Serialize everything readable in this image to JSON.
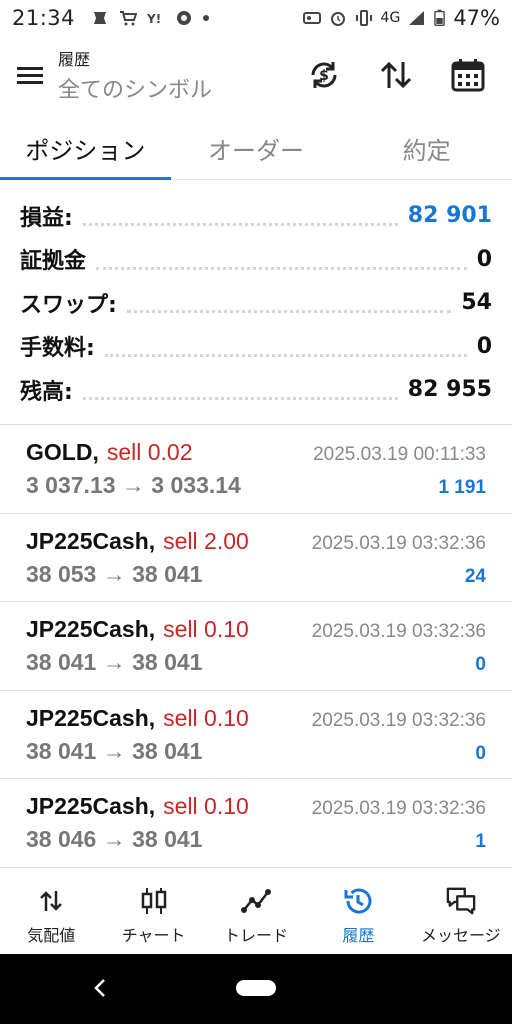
{
  "status_bar": {
    "time": "21:34",
    "network": "4G",
    "battery": "47%"
  },
  "appbar": {
    "title": "履歴",
    "subtitle": "全てのシンボル",
    "icons": [
      "menu-icon",
      "currency-sync-icon",
      "sort-icon",
      "calendar-icon"
    ]
  },
  "tabs": [
    {
      "label": "ポジション",
      "active": true
    },
    {
      "label": "オーダー",
      "active": false
    },
    {
      "label": "約定",
      "active": false
    }
  ],
  "summary": [
    {
      "label": "損益:",
      "value": "82 901",
      "color": "#1976d2"
    },
    {
      "label": "証拠金",
      "value": "0",
      "color": "#111111"
    },
    {
      "label": "スワップ:",
      "value": "54",
      "color": "#111111"
    },
    {
      "label": "手数料:",
      "value": "0",
      "color": "#111111"
    },
    {
      "label": "残高:",
      "value": "82 955",
      "color": "#111111"
    }
  ],
  "deals": [
    {
      "symbol": "GOLD,",
      "side": "sell 0.02",
      "time": "2025.03.19 00:11:33",
      "prices": "3 037.13 → 3 033.14",
      "profit": "1 191"
    },
    {
      "symbol": "JP225Cash,",
      "side": "sell 2.00",
      "time": "2025.03.19 03:32:36",
      "prices": "38 053 → 38 041",
      "profit": "24"
    },
    {
      "symbol": "JP225Cash,",
      "side": "sell 0.10",
      "time": "2025.03.19 03:32:36",
      "prices": "38 041 → 38 041",
      "profit": "0"
    },
    {
      "symbol": "JP225Cash,",
      "side": "sell 0.10",
      "time": "2025.03.19 03:32:36",
      "prices": "38 041 → 38 041",
      "profit": "0"
    },
    {
      "symbol": "JP225Cash,",
      "side": "sell 0.10",
      "time": "2025.03.19 03:32:36",
      "prices": "38 046 → 38 041",
      "profit": "1"
    }
  ],
  "bottom_nav": [
    {
      "label": "気配値",
      "icon": "quotes-icon",
      "active": false
    },
    {
      "label": "チャート",
      "icon": "chart-candles-icon",
      "active": false
    },
    {
      "label": "トレード",
      "icon": "trade-icon",
      "active": false
    },
    {
      "label": "履歴",
      "icon": "history-icon",
      "active": true
    },
    {
      "label": "メッセージ",
      "icon": "messages-icon",
      "active": false
    }
  ],
  "colors": {
    "accent": "#1976d2",
    "sell": "#c62828",
    "muted": "#888888"
  }
}
